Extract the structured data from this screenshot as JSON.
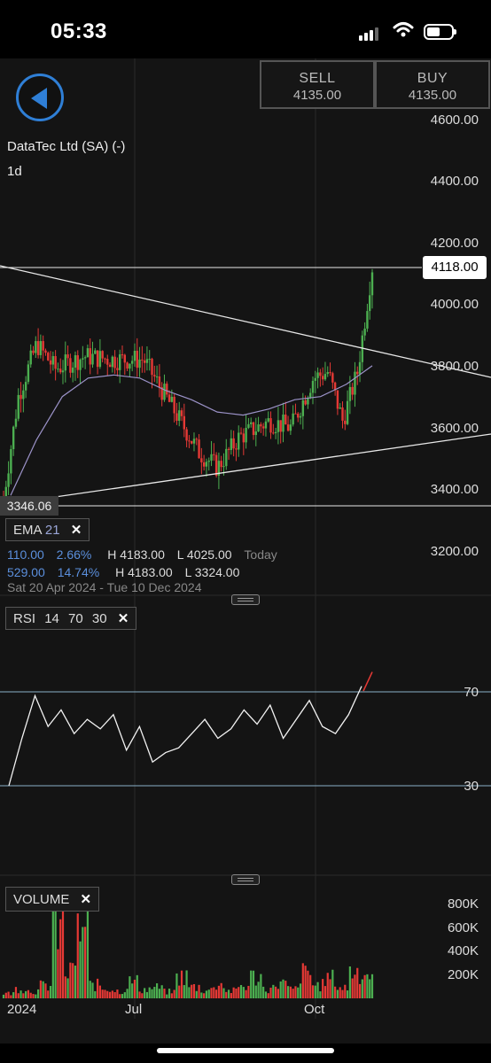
{
  "status_bar": {
    "time": "05:33"
  },
  "trade": {
    "sell_label": "SELL",
    "sell_price": "4135.00",
    "buy_label": "BUY",
    "buy_price": "4135.00"
  },
  "instrument": {
    "name": "DataTec Ltd (SA) (-)",
    "period": "1d"
  },
  "price_axis": [
    "4600.00",
    "4400.00",
    "4200.00",
    "4000.00",
    "3800.00",
    "3600.00",
    "3400.00",
    "3200.00"
  ],
  "last_price_tag": "4118.00",
  "low_tag": "3346.06",
  "ema": {
    "label": "EMA",
    "period": "21",
    "row1": {
      "change": "110.00",
      "pct": "2.66%",
      "high": "H 4183.00",
      "low": "L 4025.00",
      "when": "Today"
    },
    "row2": {
      "change": "529.00",
      "pct": "14.74%",
      "high": "H 4183.00",
      "low": "L 3324.00"
    },
    "date_range": "Sat 20 Apr 2024 - Tue 10 Dec 2024"
  },
  "rsi": {
    "label": "RSI",
    "p1": "14",
    "p2": "70",
    "p3": "30",
    "upper_label": "70",
    "lower_label": "30"
  },
  "volume": {
    "label": "VOLUME",
    "axis": [
      "800K",
      "600K",
      "400K",
      "200K"
    ]
  },
  "x_axis": [
    "2024",
    "Jul",
    "Oct"
  ],
  "colors": {
    "up": "#4caf50",
    "down": "#e53935",
    "ema_line": "#9c93c9",
    "accent": "#2f7fd6",
    "background": "#141414"
  },
  "chart_data": [
    {
      "type": "line",
      "title": "DataTec Ltd (SA) (-)",
      "ylim": [
        3200,
        4600
      ],
      "description_series": "daily candles; last close approx",
      "series": [
        {
          "name": "EMA",
          "values": [
            3380,
            3560,
            3700,
            3760,
            3770,
            3760,
            3720,
            3690,
            3650,
            3640,
            3660,
            3690,
            3700,
            3740,
            3800
          ]
        }
      ],
      "last": 4118.0,
      "period_high": 4183.0,
      "period_low": 3324.0
    },
    {
      "type": "line",
      "ylim": [
        0,
        100
      ],
      "series": [
        {
          "name": "RSI",
          "values": [
            30,
            50,
            68,
            55,
            62,
            52,
            58,
            54,
            60,
            45,
            55,
            40,
            44,
            46,
            52,
            58,
            50,
            54,
            62,
            56,
            64,
            50,
            58,
            66,
            55,
            52,
            60,
            72
          ]
        }
      ]
    },
    {
      "type": "bar",
      "ylim": [
        0,
        900000
      ],
      "series": [
        {
          "name": "VOLUME",
          "values": [
            60000,
            120000,
            90000,
            150000,
            820000,
            300000,
            820000,
            160000,
            120000,
            90000,
            200000,
            110000,
            130000,
            80000,
            260000,
            140000,
            100000,
            170000,
            90000,
            150000,
            260000,
            120000,
            180000,
            110000,
            300000,
            160000,
            240000,
            130000,
            330000,
            300000
          ]
        }
      ]
    }
  ]
}
